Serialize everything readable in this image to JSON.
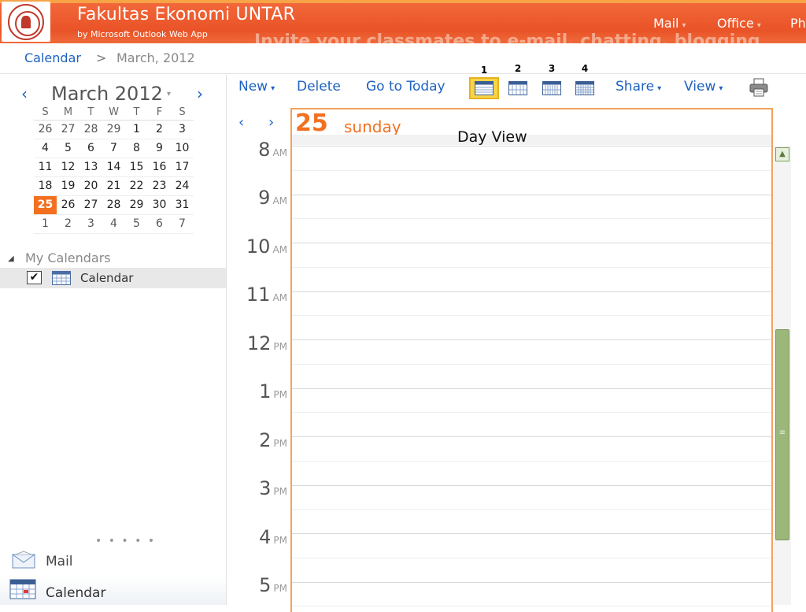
{
  "header": {
    "title": "Fakultas Ekonomi UNTAR",
    "subtitle": "by Microsoft Outlook Web App",
    "invite_text": "Invite your classmates to e-mail, chatting, blogging",
    "nav": [
      {
        "label": "Mail",
        "caret": "▾"
      },
      {
        "label": "Office",
        "caret": "▾"
      },
      {
        "label": "Ph"
      }
    ]
  },
  "breadcrumb": {
    "root": "Calendar",
    "separator": ">",
    "current": "March, 2012"
  },
  "mini_calendar": {
    "title": "March 2012",
    "caret": "▾",
    "prev": "‹",
    "next": "›",
    "weekdays": [
      "S",
      "M",
      "T",
      "W",
      "T",
      "F",
      "S"
    ],
    "weeks": [
      [
        "26",
        "27",
        "28",
        "29",
        "1",
        "2",
        "3"
      ],
      [
        "4",
        "5",
        "6",
        "7",
        "8",
        "9",
        "10"
      ],
      [
        "11",
        "12",
        "13",
        "14",
        "15",
        "16",
        "17"
      ],
      [
        "18",
        "19",
        "20",
        "21",
        "22",
        "23",
        "24"
      ],
      [
        "25",
        "26",
        "27",
        "28",
        "29",
        "30",
        "31"
      ],
      [
        "1",
        "2",
        "3",
        "4",
        "5",
        "6",
        "7"
      ]
    ],
    "today": "25"
  },
  "my_calendars": {
    "heading": "My Calendars",
    "items": [
      {
        "label": "Calendar",
        "checked": true
      }
    ]
  },
  "bottom_nav": {
    "dots": "• • • • •",
    "mail": "Mail",
    "calendar": "Calendar"
  },
  "toolbar": {
    "new": "New",
    "delete": "Delete",
    "today": "Go to Today",
    "share": "Share",
    "view": "View",
    "caret": "▾",
    "view_buttons": [
      {
        "number": "1",
        "name": "Day View",
        "active": true
      },
      {
        "number": "2",
        "name": "Work Week View",
        "active": false
      },
      {
        "number": "3",
        "name": "Week View",
        "active": false
      },
      {
        "number": "4",
        "name": "Month View",
        "active": false
      }
    ]
  },
  "day_view": {
    "prev": "‹",
    "next": "›",
    "day_number": "25",
    "day_name": "sunday",
    "hours": [
      {
        "h": "8",
        "ap": "AM"
      },
      {
        "h": "9",
        "ap": "AM"
      },
      {
        "h": "10",
        "ap": "AM"
      },
      {
        "h": "11",
        "ap": "AM"
      },
      {
        "h": "12",
        "ap": "PM"
      },
      {
        "h": "1",
        "ap": "PM"
      },
      {
        "h": "2",
        "ap": "PM"
      },
      {
        "h": "3",
        "ap": "PM"
      },
      {
        "h": "4",
        "ap": "PM"
      },
      {
        "h": "5",
        "ap": "PM"
      }
    ]
  },
  "colors": {
    "brand_orange": "#f37021",
    "header_orange": "#e95327",
    "link_blue": "#1e62c0",
    "active_view": "#f8d44a",
    "scrollbar_green": "#9bb77a"
  }
}
